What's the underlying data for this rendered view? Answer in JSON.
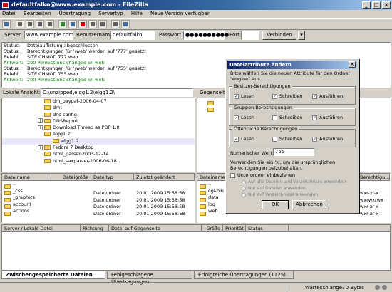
{
  "window": {
    "title": "defaultfalko@www.example.com - FileZilla"
  },
  "menu": [
    "Datei",
    "Bearbeiten",
    "Übertragung",
    "Servertyp",
    "Hilfe",
    "Neue Version verfügbar"
  ],
  "quickconnect": {
    "server_label": "Server:",
    "server_value": "www.example.com",
    "user_label": "Benutzername:",
    "user_value": "defaultfalko",
    "pass_label": "Passwort:",
    "pass_value": "●●●●●●●●●●",
    "port_label": "Port:",
    "port_value": "",
    "connect_label": "Verbinden"
  },
  "log": [
    {
      "k": "Status:",
      "v": "Dateiauflistung abgeschlossen",
      "green": false
    },
    {
      "k": "Status:",
      "v": "Berechtigungen für '/web' werden auf '777' gesetzt",
      "green": false
    },
    {
      "k": "Befehl:",
      "v": "SITE CHMOD 777 web",
      "green": false
    },
    {
      "k": "Antwort:",
      "v": "200 Permissions changed on web",
      "green": true
    },
    {
      "k": "Status:",
      "v": "Berechtigungen für '/web' werden auf '755' gesetzt",
      "green": false
    },
    {
      "k": "Befehl:",
      "v": "SITE CHMOD 755 web",
      "green": false
    },
    {
      "k": "Antwort:",
      "v": "200 Permissions changed on web",
      "green": true
    }
  ],
  "local": {
    "label": "Lokale Ansicht:",
    "path": "C:\\unzipped\\elgg1.2\\elgg1.2\\",
    "tree": [
      {
        "name": "dm_paypal-2006-04-07",
        "indent": 1,
        "plus": false
      },
      {
        "name": "dmt",
        "indent": 1,
        "plus": false
      },
      {
        "name": "dns-config",
        "indent": 1,
        "plus": false
      },
      {
        "name": "DNSReport",
        "indent": 1,
        "plus": true
      },
      {
        "name": "Download Thread as PDF 1.0",
        "indent": 1,
        "plus": true
      },
      {
        "name": "elgg1.2",
        "indent": 1,
        "plus": false
      },
      {
        "name": "elgg1.2",
        "indent": 2,
        "plus": false
      },
      {
        "name": "Fedora 7 Desktop",
        "indent": 1,
        "plus": true
      },
      {
        "name": "html_parser-2003-12-14",
        "indent": 1,
        "plus": false
      },
      {
        "name": "html_saxparser-2006-06-18",
        "indent": 1,
        "plus": false
      }
    ],
    "headers": [
      "Dateiname",
      "Dateigröße",
      "Dateityp",
      "Zuletzt geändert"
    ],
    "files": [
      {
        "name": "..",
        "size": "",
        "type": "",
        "date": ""
      },
      {
        "name": "_css",
        "size": "",
        "type": "Dateiordner",
        "date": "20.01.2009 15:58:58"
      },
      {
        "name": "_graphics",
        "size": "",
        "type": "Dateiordner",
        "date": "20.01.2009 15:58:58"
      },
      {
        "name": "account",
        "size": "",
        "type": "Dateiordner",
        "date": "20.01.2009 15:58:58"
      },
      {
        "name": "actions",
        "size": "",
        "type": "Dateiordner",
        "date": "20.01.2009 15:58:58"
      }
    ]
  },
  "remote": {
    "label": "Gegenseite",
    "headers": [
      "Dateiname",
      "Berechtigu..."
    ],
    "files": [
      {
        "name": "..",
        "perm": ""
      },
      {
        "name": "cgi-bin",
        "perm": "wxr-xr-x"
      },
      {
        "name": "data",
        "perm": "wxrwxrwx"
      },
      {
        "name": "log",
        "perm": "wxr-xr-x"
      },
      {
        "name": "web",
        "perm": "wxr-xr-x"
      }
    ]
  },
  "queue": {
    "headers": [
      "Server / Lokale Datei",
      "Richtung",
      "Datei auf Gegenseite",
      "Größe",
      "Priorität",
      "Status"
    ]
  },
  "tabs": [
    "Zwischengespeicherte Dateien",
    "Fehlgeschlagene Übertragungen",
    "Erfolgreiche Übertragungen (1125)"
  ],
  "statusbar": {
    "queue": "Warteschlange: 0 Bytes"
  },
  "dialog": {
    "title": "Dateiattribute ändern",
    "intro": "Bitte wählen Sie die neuen Attribute für den Ordner \"engine\" aus.",
    "groups": [
      {
        "label": "Besitzer-Berechtigungen",
        "read": "Lesen",
        "write": "Schreiben",
        "exec": "Ausführen"
      },
      {
        "label": "Gruppen Berechtigungen",
        "read": "Lesen",
        "write": "Schreiben",
        "exec": "Ausführen"
      },
      {
        "label": "Öffentliche Berechtigungen",
        "read": "Lesen",
        "write": "Schreiben",
        "exec": "Ausführen"
      }
    ],
    "numeric_label": "Numerischer Wert:",
    "numeric_value": "755",
    "note": "Verwenden Sie ein 'x', um die ursprünglichen Berechtigungen beizubehalten.",
    "recurse_label": "Unterordner einbeziehen",
    "radio1": "Auf alle Dateien und Verzeichnisse anwenden",
    "radio2": "Nur auf Dateien anwenden",
    "radio3": "Nur auf Verzeichnisse anwenden",
    "ok": "OK",
    "cancel": "Abbrechen"
  }
}
